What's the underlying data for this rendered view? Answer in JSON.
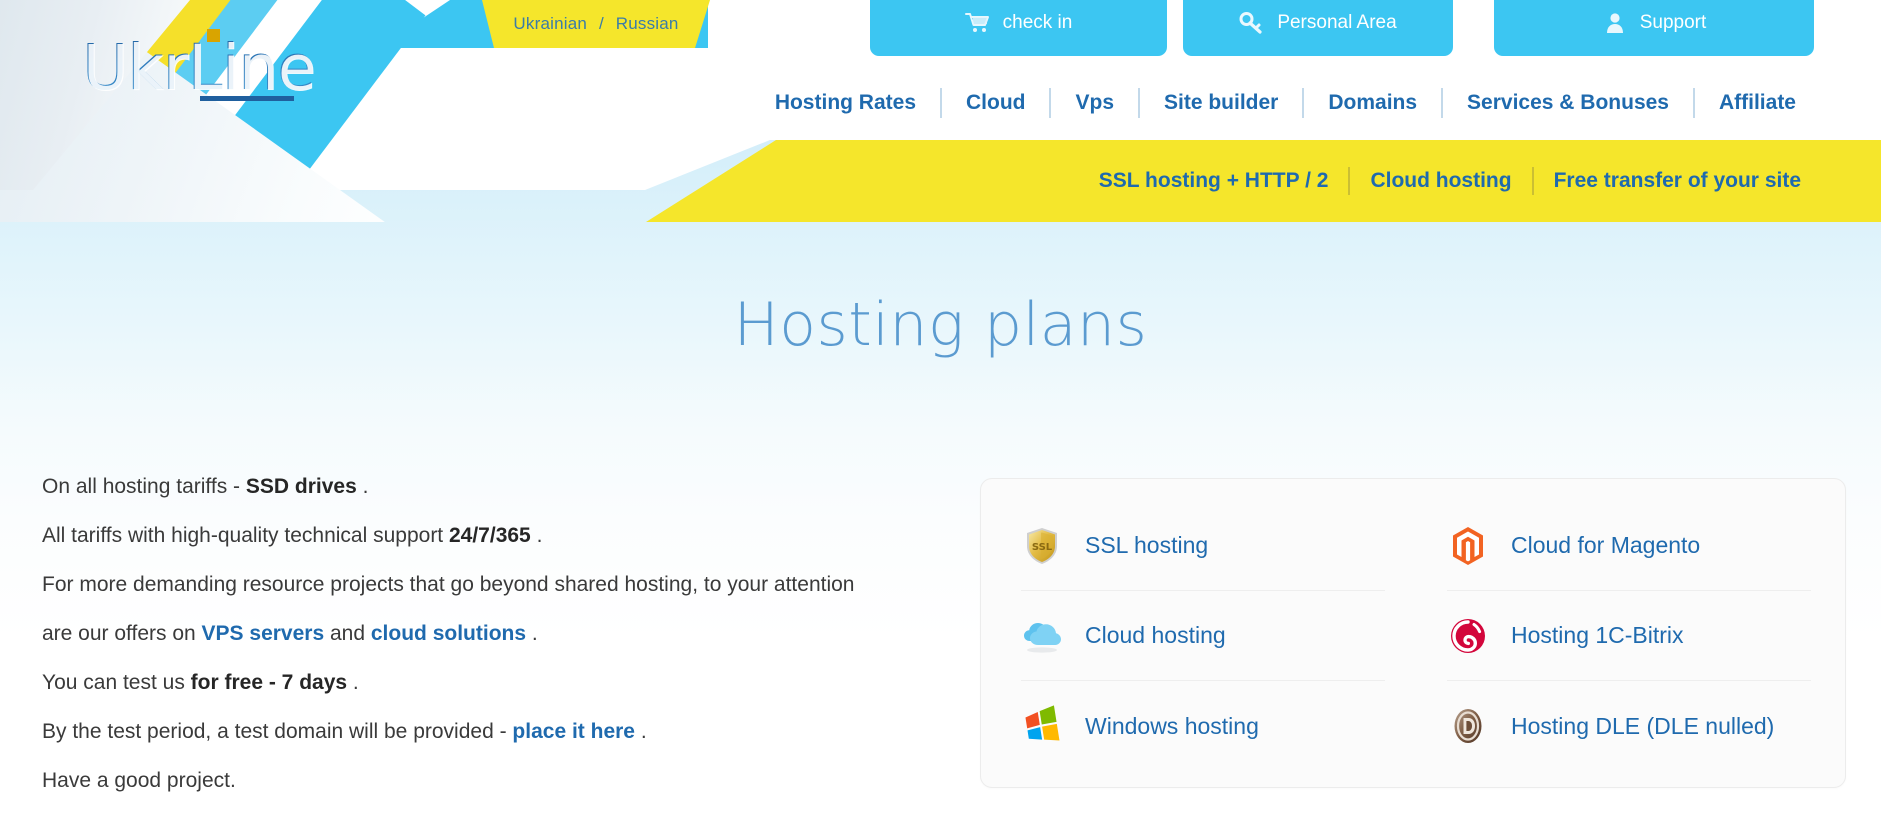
{
  "brand": {
    "name": "UkrLine",
    "name_part1": "Ukr",
    "name_part2": "Line"
  },
  "topbar": {
    "languages": [
      {
        "label": "Ukrainian",
        "icon": ""
      },
      {
        "label": "Russian",
        "icon": ""
      }
    ],
    "lang_separator": "/",
    "tabs": [
      {
        "label": "check in",
        "icon": "shopping-cart-icon"
      },
      {
        "label": "Personal Area",
        "icon": "key-icon"
      },
      {
        "label": "Support",
        "icon": "user-icon"
      }
    ]
  },
  "mainnav": {
    "items": [
      {
        "label": "Hosting Rates"
      },
      {
        "label": "Cloud"
      },
      {
        "label": "Vps"
      },
      {
        "label": "Site builder"
      },
      {
        "label": "Domains"
      },
      {
        "label": "Services & Bonuses"
      },
      {
        "label": "Affiliate"
      }
    ]
  },
  "promo_banner": {
    "items": [
      {
        "label": "SSL hosting + HTTP / 2"
      },
      {
        "label": "Cloud hosting"
      },
      {
        "label": "Free transfer of your site"
      }
    ]
  },
  "page": {
    "title": "Hosting plans"
  },
  "intro": {
    "line1_a": "On all hosting tariffs - ",
    "line1_b": "SSD drives",
    "line1_c": " .",
    "line2_a": "All tariffs with high-quality technical support ",
    "line2_b": "24/7/365",
    "line2_c": " .",
    "line3_a": "For more demanding resource projects that go beyond shared hosting, to your attention are our offers on ",
    "line3_link1": "VPS servers",
    "line3_b": " and ",
    "line3_link2": "cloud solutions",
    "line3_c": " .",
    "line4_a": "You can test us ",
    "line4_b": "for free - 7 days",
    "line4_c": " .",
    "line5_a": "By the test period, a test domain will be provided - ",
    "line5_link": "place it here",
    "line5_c": " .",
    "line6": "Have a good project."
  },
  "services": {
    "items": [
      {
        "label": "SSL hosting",
        "icon": "ssl-shield-icon"
      },
      {
        "label": "Cloud for Magento",
        "icon": "magento-icon"
      },
      {
        "label": "Cloud hosting",
        "icon": "cloud-icon"
      },
      {
        "label": "Hosting 1C-Bitrix",
        "icon": "bitrix-icon"
      },
      {
        "label": "Windows hosting",
        "icon": "windows-icon"
      },
      {
        "label": "Hosting DLE (DLE nulled)",
        "icon": "dle-icon"
      }
    ]
  },
  "colors": {
    "cyan": "#3cc6f2",
    "yellow": "#f5e62b",
    "link_blue": "#1f6aae",
    "title_blue": "#5b9bd0",
    "body_text": "#3a3a3a"
  }
}
